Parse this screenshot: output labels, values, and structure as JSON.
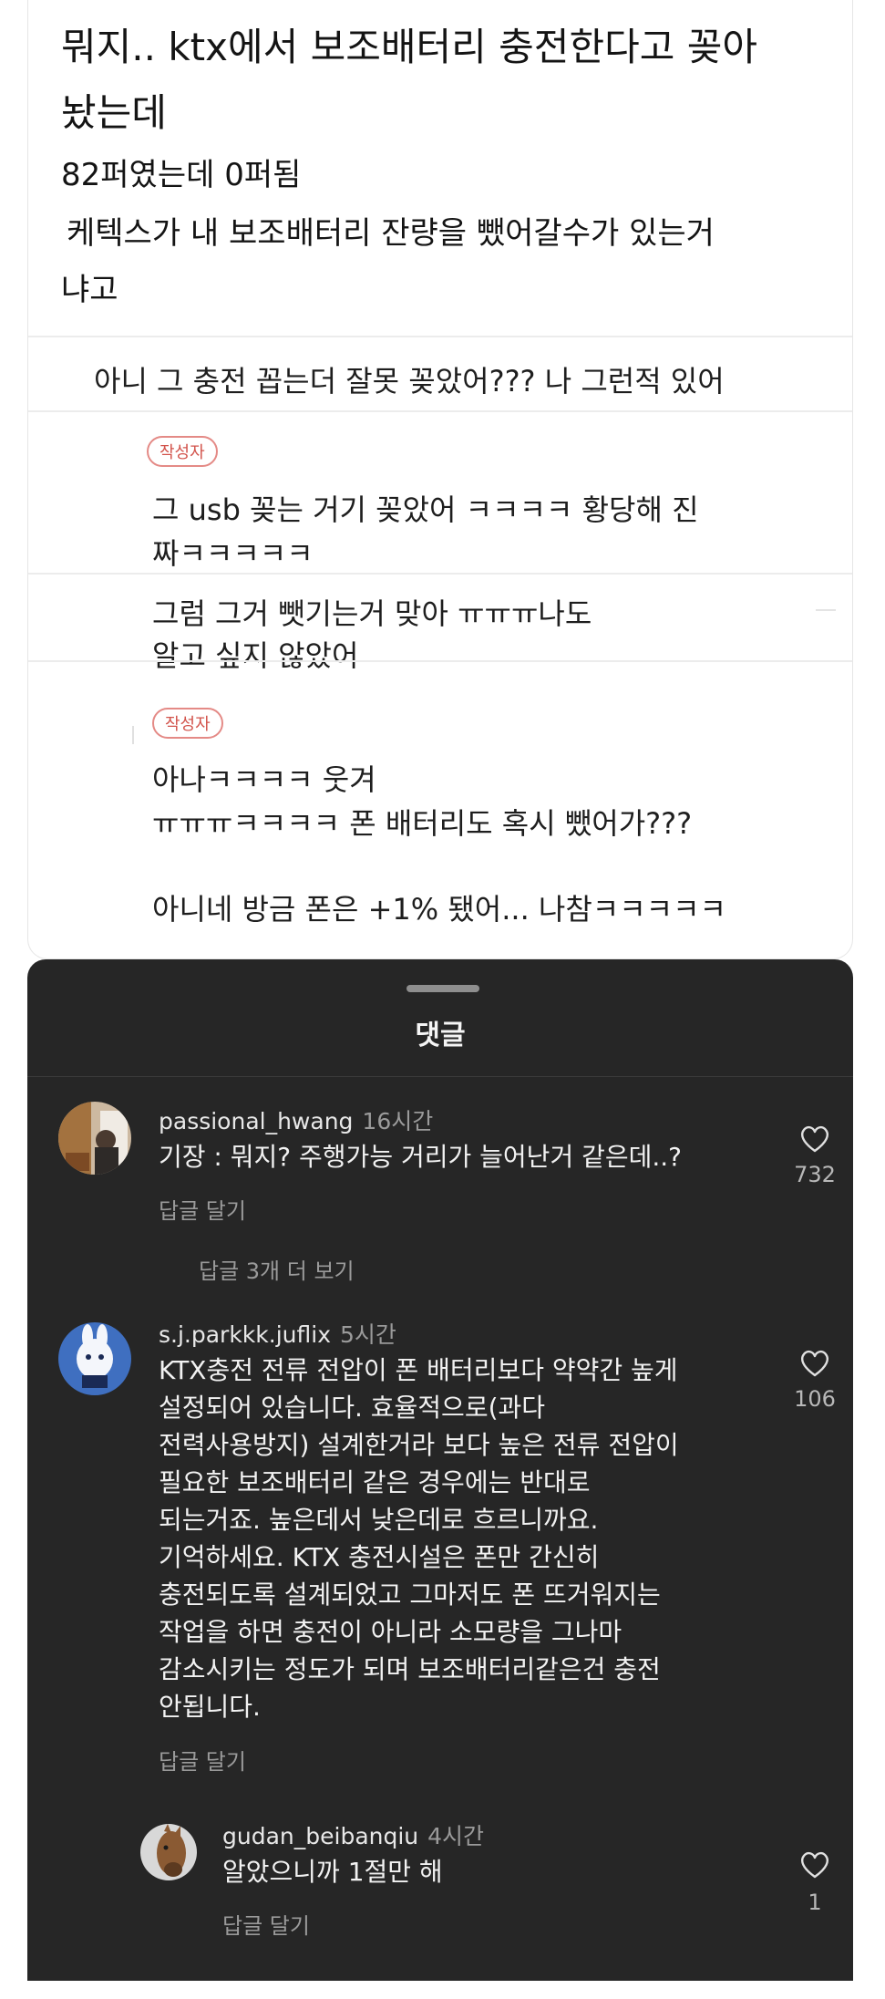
{
  "post": {
    "title_line1": "뭐지.. ktx에서 보조배터리 충전한다고 꽂아",
    "title_line2": "놨는데",
    "body_line1": "82퍼였는데 0퍼됨",
    "body_line2": "케텍스가 내 보조배터리 잔량을 뺐어갈수가 있는거",
    "body_line3": "냐고"
  },
  "thread": {
    "c1": "아니 그 충전 꼽는더 잘못 꽂았어??? 나 그런적 있어",
    "author_badge": "작성자",
    "c2_line1": "그 usb 꽂는 거기 꽂았어 ㅋㅋㅋㅋ 황당해 진",
    "c2_line2": "짜ㅋㅋㅋㅋㅋ",
    "c3_line1": "그럼 그거 뺏기는거 맞아 ㅠㅠㅠ나도",
    "c3_line2": "알고 싶지 않았어",
    "c4_line1": "아나ㅋㅋㅋㅋ 웃겨",
    "c4_line2": "ㅠㅠㅠㅋㅋㅋㅋ 폰 배터리도 혹시 뺐어가???",
    "c4_line3": "아니네 방금 폰은 +1% 됐어... 나참ㅋㅋㅋㅋㅋ"
  },
  "sheet": {
    "title": "댓글",
    "comments": [
      {
        "username": "passional_hwang",
        "time": "16시간",
        "lines": [
          "기장 : 뭐지? 주행가능 거리가 늘어난거 같은데..?"
        ],
        "likes": "732",
        "reply_label": "답글 달기",
        "more_replies": "답글 3개 더 보기"
      },
      {
        "username": "s.j.parkkk.juflix",
        "time": "5시간",
        "lines": [
          "KTX충전 전류 전압이  폰 배터리보다 약약간 높게",
          "설정되어 있습니다. 효율적으로(과다",
          "전력사용방지) 설계한거라 보다 높은 전류 전압이",
          "필요한 보조배터리 같은 경우에는 반대로",
          "되는거죠. 높은데서 낮은데로 흐르니까요.",
          "기억하세요. KTX 충전시설은 폰만 간신히",
          "충전되도록 설계되었고 그마저도 폰 뜨거워지는",
          "작업을 하면 충전이 아니라 소모량을 그나마",
          "감소시키는 정도가 되며 보조배터리같은건 충전",
          "안됩니다."
        ],
        "likes": "106",
        "reply_label": "답글 달기"
      },
      {
        "username": "gudan_beibanqiu",
        "time": "4시간",
        "lines": [
          "알았으니까 1절만 해"
        ],
        "likes": "1",
        "reply_label": "답글 달기"
      }
    ]
  },
  "colors": {
    "sheet_bg": "#262626",
    "badge": "#d2534b"
  }
}
